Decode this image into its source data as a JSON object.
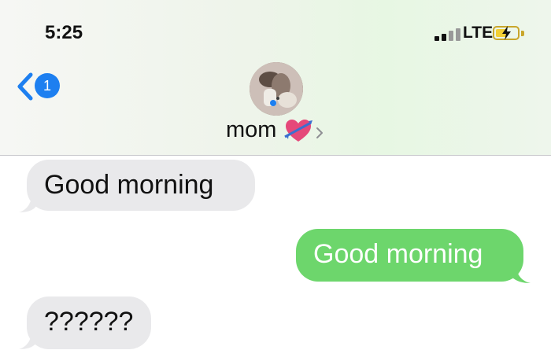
{
  "status_bar": {
    "time": "5:25",
    "network": "LTE",
    "icons": [
      "signal-bars-icon",
      "battery-charging-icon"
    ]
  },
  "header": {
    "unread_count": "1",
    "contact_name": "mom",
    "icons": [
      "back-chevron-icon",
      "heart-arrow-emoji",
      "chevron-right-icon"
    ]
  },
  "messages": [
    {
      "direction": "incoming",
      "text": "Good morning"
    },
    {
      "direction": "outgoing",
      "text": "Good morning"
    },
    {
      "direction": "incoming",
      "text": "??????"
    }
  ],
  "colors": {
    "accent_blue": "#1d7ff0",
    "outgoing_bubble": "#6dd66c",
    "incoming_bubble": "#e9e9eb"
  }
}
